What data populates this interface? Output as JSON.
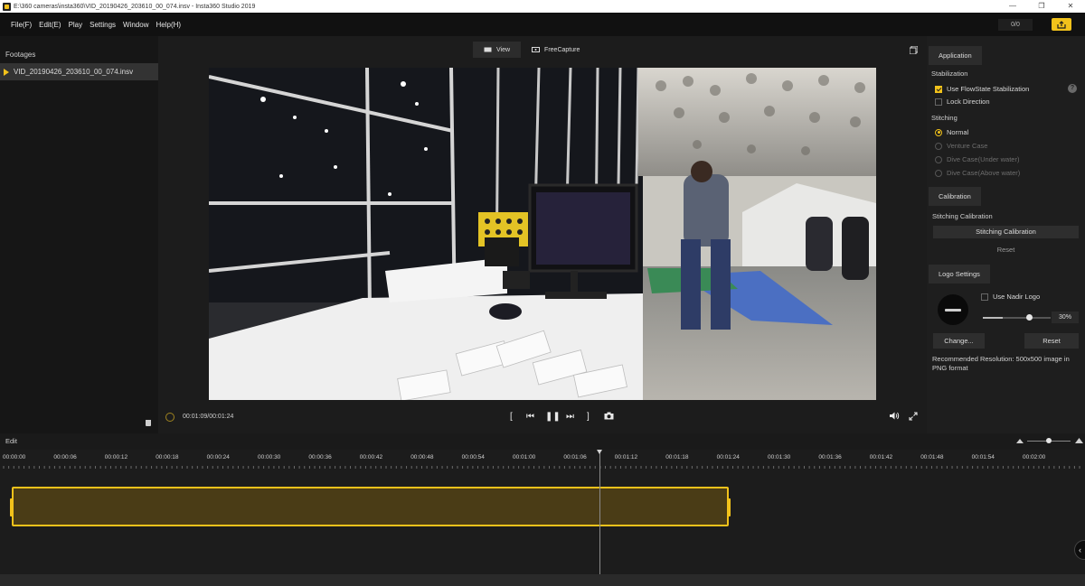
{
  "window": {
    "title": "E:\\360 cameras\\insta360\\VID_20190426_203610_00_074.insv - Insta360 Studio 2019"
  },
  "menu": {
    "items": [
      "File(F)",
      "Edit(E)",
      "Play",
      "Settings",
      "Window",
      "Help(H)"
    ],
    "counter": "0/0"
  },
  "footages": {
    "title": "Footages",
    "items": [
      "VID_20190426_203610_00_074.insv"
    ]
  },
  "view_tabs": {
    "view": "View",
    "freecapture": "FreeCapture"
  },
  "player": {
    "time": "00:01:09/00:01:24"
  },
  "panel": {
    "application_tab": "Application",
    "stabilization_title": "Stabilization",
    "flowstate_label": "Use FlowState Stabilization",
    "help_icon": "?",
    "lock_direction_label": "Lock Direction",
    "stitching_title": "Stitching",
    "stitching_options": [
      "Normal",
      "Venture Case",
      "Dive Case(Under water)",
      "Dive Case(Above water)"
    ],
    "calibration_tab": "Calibration",
    "stitching_calibration_title": "Stitching Calibration",
    "stitching_calibration_button": "Stitching Calibration",
    "reset_link": "Reset",
    "logo_settings_tab": "Logo Settings",
    "use_nadir_logo": "Use Nadir Logo",
    "logo_opacity": "30%",
    "change_button": "Change...",
    "reset_button": "Reset",
    "recommended_text": "Recommended Resolution: 500x500 image in PNG format"
  },
  "edit": {
    "label": "Edit"
  },
  "timeline": {
    "ticks": [
      "00:00:00",
      "00:00:06",
      "00:00:12",
      "00:00:18",
      "00:00:24",
      "00:00:30",
      "00:00:36",
      "00:00:42",
      "00:00:48",
      "00:00:54",
      "00:01:00",
      "00:01:06",
      "00:01:12",
      "00:01:18",
      "00:01:24",
      "00:01:30",
      "00:01:36",
      "00:01:42",
      "00:01:48",
      "00:01:54",
      "00:02:00"
    ],
    "zoom_level": 0.5
  },
  "colors": {
    "accent": "#f2c21b",
    "panel": "#1e1e1e",
    "clip_fill": "#4a3c16"
  }
}
